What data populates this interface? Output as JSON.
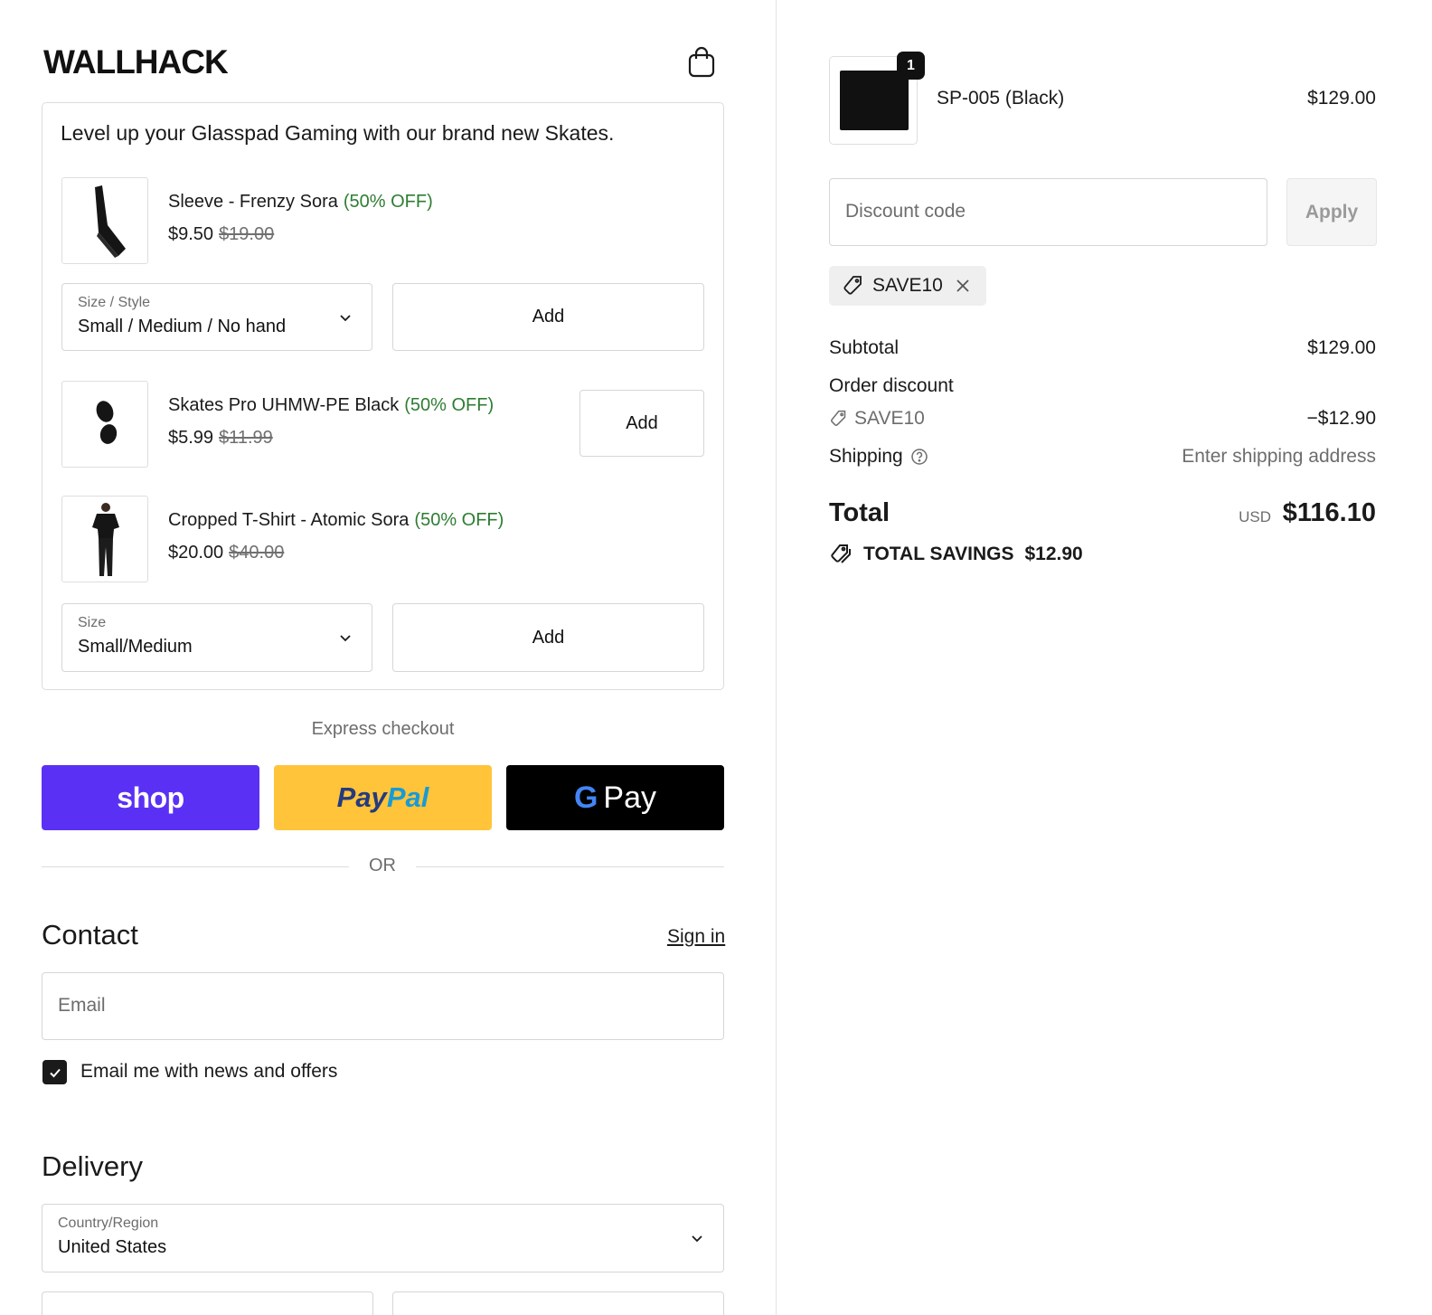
{
  "brand": {
    "logo": "WALLHACK"
  },
  "upsell": {
    "title": "Level up your Glasspad Gaming with our brand new Skates.",
    "items": [
      {
        "name": "Sleeve - Frenzy Sora",
        "discount": "(50% OFF)",
        "price": "$9.50",
        "compare_price": "$19.00",
        "select_label": "Size / Style",
        "select_value": "Small / Medium / No hand",
        "add_label": "Add"
      },
      {
        "name": "Skates Pro UHMW-PE Black",
        "discount": "(50% OFF)",
        "price": "$5.99",
        "compare_price": "$11.99",
        "add_label": "Add"
      },
      {
        "name": "Cropped T-Shirt - Atomic Sora",
        "discount": "(50% OFF)",
        "price": "$20.00",
        "compare_price": "$40.00",
        "select_label": "Size",
        "select_value": "Small/Medium",
        "add_label": "Add"
      }
    ]
  },
  "express": {
    "label": "Express checkout",
    "shop_label": "shop",
    "paypal_label_1": "Pay",
    "paypal_label_2": "Pal",
    "gpay_g": "G",
    "gpay_label": "Pay",
    "or_label": "OR"
  },
  "contact": {
    "heading": "Contact",
    "signin_label": "Sign in",
    "email_placeholder": "Email",
    "newsletter_label": "Email me with news and offers",
    "newsletter_checked": true
  },
  "delivery": {
    "heading": "Delivery",
    "country_label": "Country/Region",
    "country_value": "United States"
  },
  "order": {
    "item": {
      "name": "SP-005 (Black)",
      "price": "$129.00",
      "quantity": "1"
    },
    "discount_placeholder": "Discount code",
    "apply_label": "Apply",
    "applied_code": "SAVE10",
    "subtotal_label": "Subtotal",
    "subtotal_value": "$129.00",
    "order_discount_label": "Order discount",
    "order_discount_code": "SAVE10",
    "order_discount_value": "−$12.90",
    "shipping_label": "Shipping",
    "shipping_value": "Enter shipping address",
    "total_label": "Total",
    "currency": "USD",
    "total_value": "$116.10",
    "savings_label": "TOTAL SAVINGS",
    "savings_value": "$12.90"
  },
  "colors": {
    "shop": "#5a31f4",
    "paypal": "#ffc439",
    "gpay": "#000000",
    "discount_green": "#2e7d32"
  },
  "icons": [
    "shopping-bag-icon",
    "chevron-down-icon",
    "check-icon",
    "tag-icon",
    "close-icon",
    "help-circle-icon",
    "tags-icon"
  ]
}
